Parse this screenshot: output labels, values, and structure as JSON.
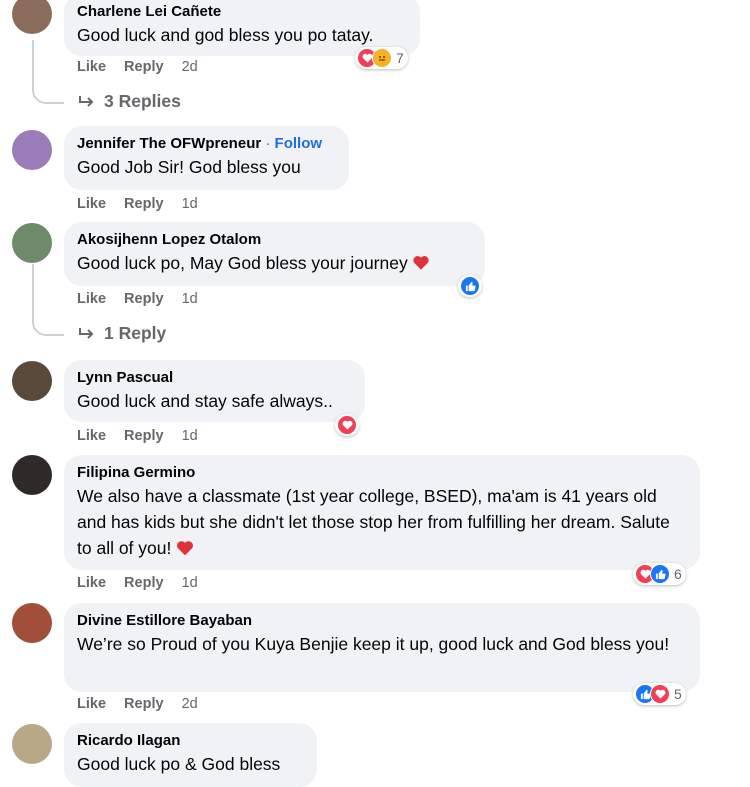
{
  "comments": [
    {
      "author": "Charlene Lei Cañete",
      "text": "Good luck and god bless you po tatay.",
      "like": "Like",
      "reply": "Reply",
      "time": "2d",
      "reaction_count": "7",
      "replies": "3 Replies",
      "avatar_color": "#8a6d5a"
    },
    {
      "author": "Jennifer The OFWpreneur",
      "dot": "·",
      "follow": "Follow",
      "text": "Good Job Sir! God bless you",
      "like": "Like",
      "reply": "Reply",
      "time": "1d",
      "avatar_color": "#9b7bb8"
    },
    {
      "author": "Akosijhenn Lopez Otalom",
      "text": "Good luck po, May God bless your journey",
      "like": "Like",
      "reply": "Reply",
      "time": "1d",
      "replies": "1 Reply",
      "avatar_color": "#6f8a6a"
    },
    {
      "author": "Lynn Pascual",
      "text": "Good luck and stay safe always..",
      "like": "Like",
      "reply": "Reply",
      "time": "1d",
      "avatar_color": "#5a4a3c"
    },
    {
      "author": "Filipina Germino",
      "text": "We also have a classmate (1st year college, BSED), ma'am is 41 years old and has kids but she didn't let those stop her from fulfilling her dream. Salute to all of you!",
      "like": "Like",
      "reply": "Reply",
      "time": "1d",
      "reaction_count": "6",
      "avatar_color": "#2e2a2a"
    },
    {
      "author": "Divine Estillore Bayaban",
      "text": "We’re so Proud of you Kuya Benjie keep it up, good luck and God bless you!",
      "like": "Like",
      "reply": "Reply",
      "time": "2d",
      "reaction_count": "5",
      "avatar_color": "#a0503a"
    },
    {
      "author": "Ricardo Ilagan",
      "text": "Good luck po & God bless",
      "avatar_color": "#b8a888"
    }
  ],
  "colors": {
    "bubble": "#f0f2f5",
    "meta": "#65676b",
    "follow": "#216fdb",
    "love": "#f33e58",
    "like": "#1877f2"
  }
}
